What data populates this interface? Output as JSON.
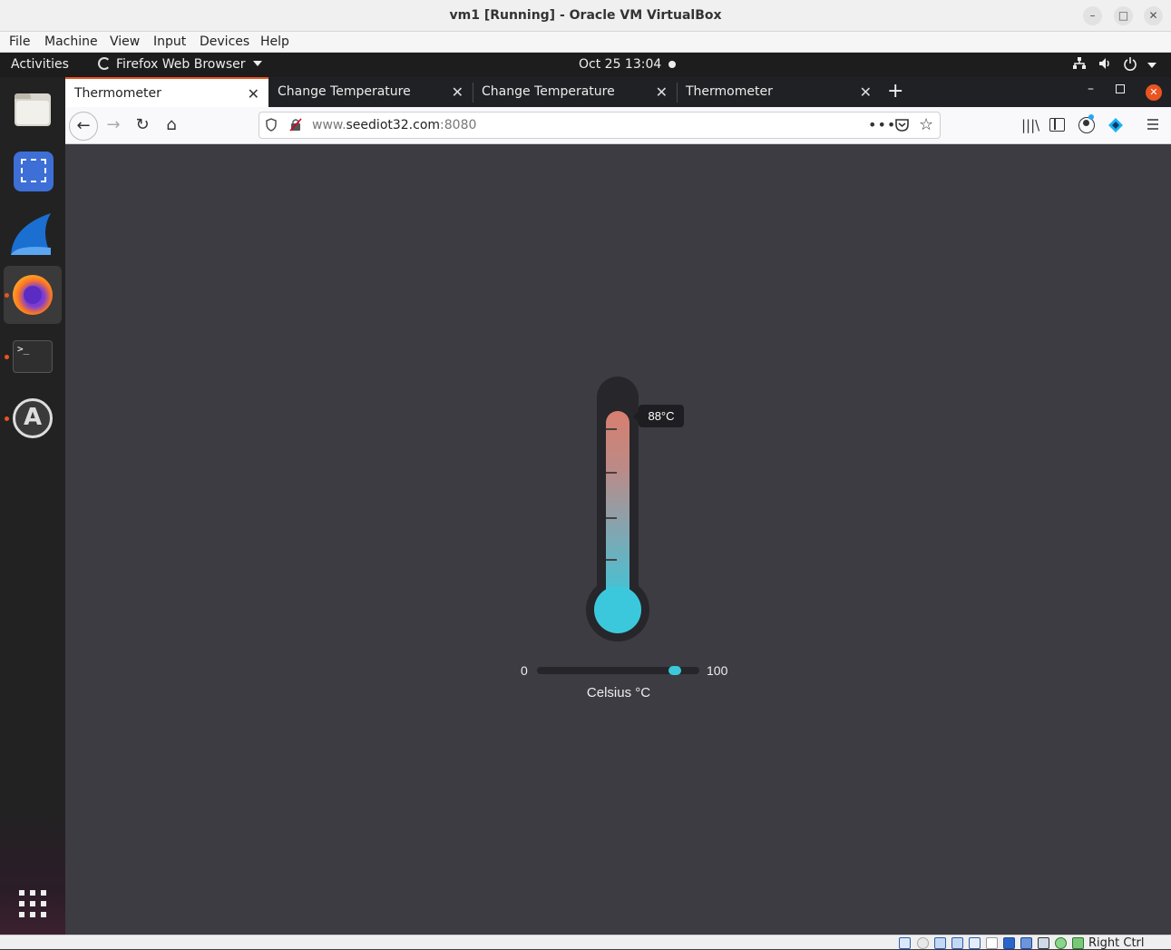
{
  "window": {
    "title": "vm1 [Running] - Oracle VM VirtualBox",
    "controls": [
      "minimize",
      "maximize",
      "close"
    ]
  },
  "vbox_menu": [
    "File",
    "Machine",
    "View",
    "Input",
    "Devices",
    "Help"
  ],
  "topbar": {
    "activities": "Activities",
    "app_name": "Firefox Web Browser",
    "clock": "Oct 25  13:04"
  },
  "dock": {
    "items": [
      "files-icon",
      "screenshot-icon",
      "wireshark-icon",
      "firefox-icon",
      "terminal-icon",
      "software-updater-icon"
    ],
    "active": "firefox-icon",
    "show_apps": "show-apps-icon"
  },
  "tabs": [
    {
      "label": "Thermometer",
      "active": true
    },
    {
      "label": "Change Temperature",
      "active": false
    },
    {
      "label": "Change Temperature",
      "active": false
    },
    {
      "label": "Thermometer",
      "active": false
    }
  ],
  "url": {
    "prefix": "www.",
    "host": "seediot32.com",
    "port": ":8080"
  },
  "thermometer": {
    "temperature_label": "88°C",
    "temperature": 88,
    "range_min": "0",
    "range_max": "100",
    "unit_label": "Celsius °C",
    "colors": {
      "hot": "#d77f70",
      "cold": "#3cc8dc",
      "frame": "#26262b"
    }
  },
  "status_bar": {
    "host_key": "Right Ctrl"
  }
}
